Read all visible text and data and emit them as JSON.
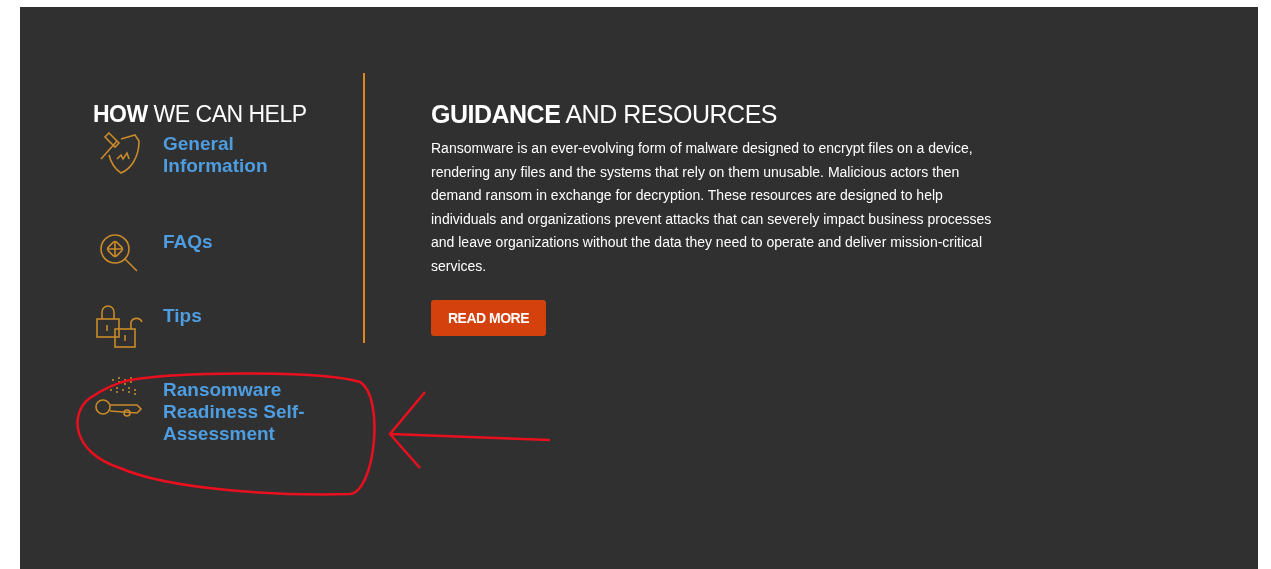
{
  "help": {
    "heading": "**HOW** WE CAN HELP",
    "items": [
      {
        "kind": "hammer-shield",
        "label": "General Information"
      },
      {
        "kind": "bug-search",
        "label": "FAQs"
      },
      {
        "kind": "padlocks",
        "label": "Tips"
      },
      {
        "kind": "key-binary",
        "label": "Ransomware Readiness Self-Assessment"
      }
    ]
  },
  "guidance": {
    "heading": "**GUIDANCE** AND RESOURCES",
    "body": "Ransomware is an ever-evolving form of malware designed to encrypt files on a device, rendering any files and the systems that rely on them unusable. Malicious actors then demand ransom in exchange for decryption. These resources are designed to help individuals and organizations prevent attacks that can severely impact business processes and leave organizations without the data they need to operate and deliver mission-critical services.",
    "button": "READ MORE"
  }
}
